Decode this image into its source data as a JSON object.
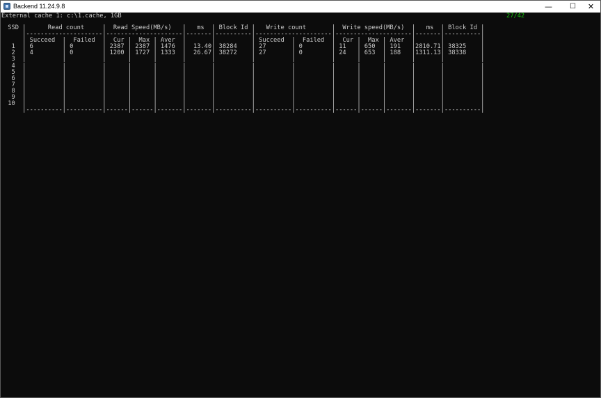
{
  "window": {
    "title": "Backend 11.24.9.8",
    "icon": "app-icon",
    "controls": {
      "minimize": "—",
      "maximize": "☐",
      "close": "✕"
    }
  },
  "console": {
    "cache_info": "External cache 1: c:\\1.cache, 1GB",
    "counter": "27/42",
    "counter_color": "#16c60c",
    "text_color": "#cccccc",
    "background": "#0c0c0c",
    "table_lines": [
      " SSD |      Read count     |  Read Speed(MB/s)   |   ms  | Block Id |   Write count       |  Write speed(MB/s)  |   ms  | Block Id |",
      "     |---------------------|---------------------|-------|----------|---------------------|---------------------|-------|----------|",
      "     | Succeed  |  Failed  |  Cur |  Max | Aver  |       |          | Succeed  |  Failed  |  Cur |  Max | Aver  |       |          |",
      "  1  | 6        | 0        | 2387 | 2387 | 1476  |  13.40| 38284    | 27       | 0        | 11   | 650  | 191   |2810.71| 38325    |",
      "  2  | 4        | 0        | 1200 | 1727 | 1333  |  26.67| 38272    | 27       | 0        | 24   | 653  | 188   |1311.13| 38338    |",
      "  3  |          |          |      |      |       |       |          |          |          |      |      |       |       |          |",
      "  4  |          |          |      |      |       |       |          |          |          |      |      |       |       |          |",
      "  5  |          |          |      |      |       |       |          |          |          |      |      |       |       |          |",
      "  6  |          |          |      |      |       |       |          |          |          |      |      |       |       |          |",
      "  7  |          |          |      |      |       |       |          |          |          |      |      |       |       |          |",
      "  8  |          |          |      |      |       |       |          |          |          |      |      |       |       |          |",
      "  9  |          |          |      |      |       |       |          |          |          |      |      |       |       |          |",
      " 10  |          |          |      |      |       |       |          |          |          |      |      |       |       |          |",
      "     |----------|----------|------|------|-------|-------|----------|----------|----------|------|------|-------|-------|----------|"
    ]
  }
}
